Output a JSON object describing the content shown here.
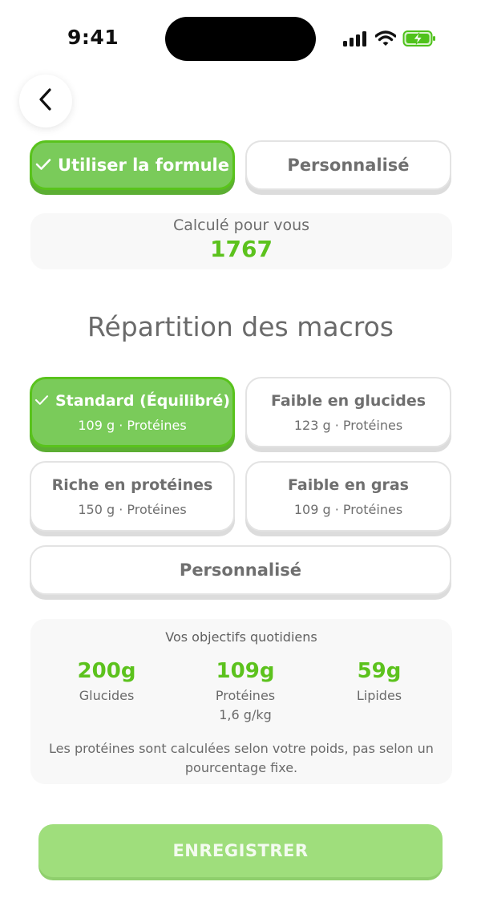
{
  "status_bar": {
    "time": "9:41"
  },
  "calories_mode": {
    "formula_label": "Utiliser la formule",
    "custom_label": "Personnalisé",
    "selected": "formula"
  },
  "calculated": {
    "label": "Calculé pour vous",
    "value": "1767"
  },
  "macros": {
    "title": "Répartition des macros",
    "options": [
      {
        "title": "Standard (Équilibré)",
        "subtitle": "109 g · Protéines",
        "selected": true
      },
      {
        "title": "Faible en glucides",
        "subtitle": "123 g · Protéines",
        "selected": false
      },
      {
        "title": "Riche en protéines",
        "subtitle": "150 g · Protéines",
        "selected": false
      },
      {
        "title": "Faible en gras",
        "subtitle": "109 g · Protéines",
        "selected": false
      }
    ],
    "custom_label": "Personnalisé"
  },
  "daily_goals": {
    "title": "Vos objectifs quotidiens",
    "items": [
      {
        "value": "200g",
        "label": "Glucides",
        "extra": ""
      },
      {
        "value": "109g",
        "label": "Protéines",
        "extra": "1,6 g/kg"
      },
      {
        "value": "59g",
        "label": "Lipides",
        "extra": ""
      }
    ],
    "note": "Les protéines sont calculées selon votre poids, pas selon un pourcentage fixe."
  },
  "save_label": "ENREGISTRER",
  "colors": {
    "accent_green": "#7acb5a",
    "value_green": "#5cc21d",
    "save_button": "#9fde7c"
  }
}
